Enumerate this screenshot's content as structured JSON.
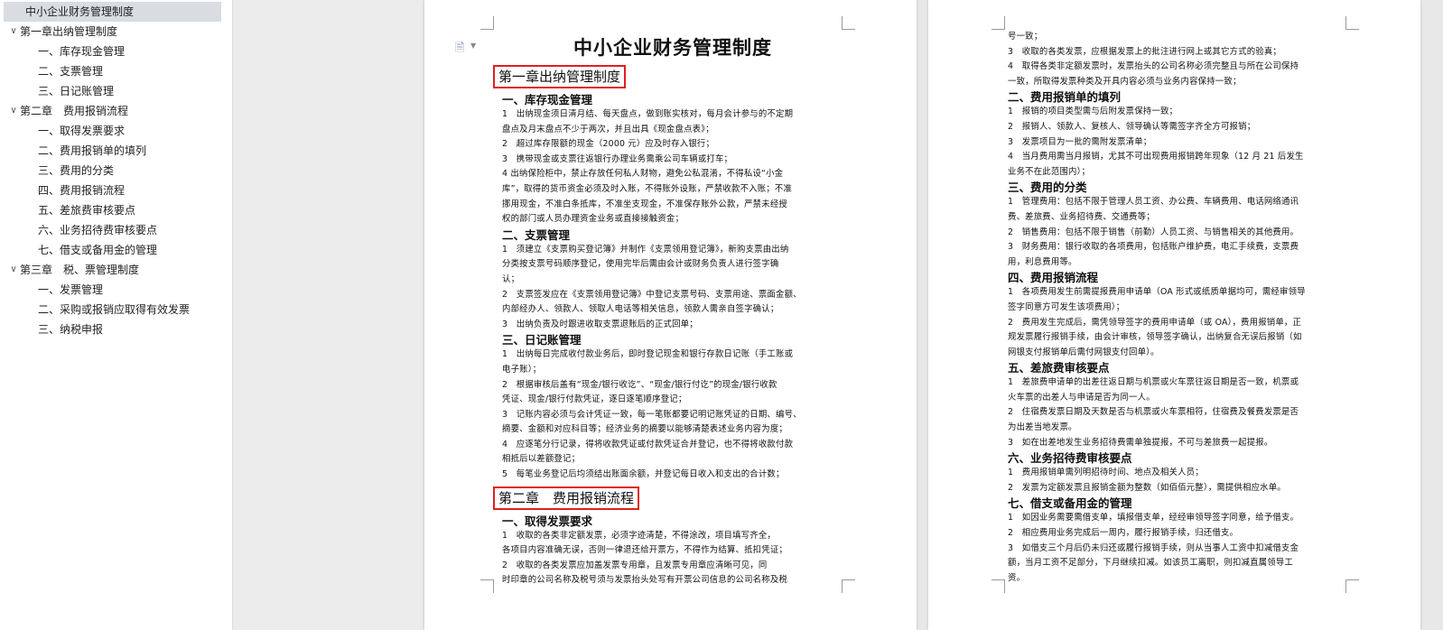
{
  "nav": {
    "root": "中小企业财务管理制度",
    "items": [
      {
        "label": "第一章出纳管理制度",
        "level": 1
      },
      {
        "label": "一、库存现金管理",
        "level": 2
      },
      {
        "label": "二、支票管理",
        "level": 2
      },
      {
        "label": "三、日记账管理",
        "level": 2
      },
      {
        "label": "第二章　费用报销流程",
        "level": 1
      },
      {
        "label": "一、取得发票要求",
        "level": 2
      },
      {
        "label": "二、费用报销单的填列",
        "level": 2
      },
      {
        "label": "三、费用的分类",
        "level": 2
      },
      {
        "label": "四、费用报销流程",
        "level": 2
      },
      {
        "label": "五、差旅费审核要点",
        "level": 2
      },
      {
        "label": "六、业务招待费审核要点",
        "level": 2
      },
      {
        "label": "七、借支或备用金的管理",
        "level": 2
      },
      {
        "label": "第三章　税、票管理制度",
        "level": 1
      },
      {
        "label": "一、发票管理",
        "level": 2
      },
      {
        "label": "二、采购或报销应取得有效发票",
        "level": 2
      },
      {
        "label": "三、纳税申报",
        "level": 2
      }
    ]
  },
  "page1": {
    "title": "中小企业财务管理制度",
    "chapter1": "第一章出纳管理制度",
    "s1": "一、库存现金管理",
    "s1_p": [
      "1　出纳现金须日清月结、每天盘点，做到账实核对，每月会计参与的不定期",
      "盘点及月末盘点不少于两次，并且出具《现金盘点表》；",
      "2　超过库存限额的现金（2000 元）应及时存入银行；",
      "3　携带现金或支票往返银行办理业务需乘公司车辆或打车；",
      "4 出纳保险柜中，禁止存放任何私人财物，避免公私混淆，不得私设“小金",
      "库”，取得的货币资金必须及时入账，不得账外设账，严禁收款不入账；不准",
      "挪用现金，不准白条抵库，不准坐支现金，不准保存账外公款，严禁未经授",
      "权的部门或人员办理资金业务或直接接触资金；"
    ],
    "s2": "二、支票管理",
    "s2_p": [
      "1　须建立《支票购买登记簿》并制作《支票领用登记簿》，新购支票由出纳",
      "分类按支票号码顺序登记，使用完毕后需由会计或财务负责人进行签字确",
      "认；",
      "2　支票签发应在《支票领用登记簿》中登记支票号码、支票用途、票面金额、",
      "内部经办人、领款人、领取人电话等相关信息，领款人需亲自签字确认；",
      "3　出纳负责及时跟进收取支票退账后的正式回单；"
    ],
    "s3": "三、日记账管理",
    "s3_p": [
      "1　出纳每日完成收付款业务后，即时登记现金和银行存款日记账（手工账或",
      "电子账）；",
      "2　根据审核后盖有“现金/银行收讫”、“现金/银行付讫”的现金/银行收款",
      "凭证、现金/银行付款凭证，逐日逐笔顺序登记；",
      "3　记账内容必须与会计凭证一致，每一笔账都要记明记账凭证的日期、编号、",
      "摘要、金额和对应科目等；经济业务的摘要以能够清楚表述业务内容为度；",
      "4　应逐笔分行记录，得将收款凭证或付款凭证合并登记，也不得将收款付款",
      "相抵后以差额登记；",
      "5　每笔业务登记后均须结出账面余额，并登记每日收入和支出的合计数；"
    ],
    "chapter2": "第二章　费用报销流程",
    "s4": "一、取得发票要求",
    "s4_p": [
      "1　收取的各类非定额发票，必须字迹清楚，不得涂改，项目填写齐全，",
      "各项目内容准确无误，否则一律退还给开票方，不得作为结算、抵扣凭证；",
      "2　收取的各类发票应加盖发票专用章，且发票专用章应清晰可见，同",
      "时印章的公司名称及税号须与发票抬头处写有开票公司信息的公司名称及税"
    ]
  },
  "page2": {
    "p0": [
      "号一致；",
      "3　收取的各类发票，应根据发票上的批注进行网上或其它方式的验真；",
      "4　取得各类非定额发票时，发票抬头的公司名称必须完整且与所在公司保持",
      "一致，所取得发票种类及开具内容必须与业务内容保持一致；"
    ],
    "s2": "二、费用报销单的填列",
    "s2_p": [
      "1　报销的项目类型需与后附发票保持一致；",
      "2　报销人、领款人、复核人、领导确认等需签字齐全方可报销；",
      "3　发票项目为一批的需附发票清单；",
      "4　当月费用需当月报销，尤其不可出现费用报销跨年现象（12 月 21 后发生",
      "业务不在此范围内）；"
    ],
    "s3": "三、费用的分类",
    "s3_p": [
      "1　管理费用：包括不限于管理人员工资、办公费、车辆费用、电话网络通讯",
      "费、差旅费、业务招待费、交通费等；",
      "2　销售费用：包括不限于销售（前勤）人员工资、与销售相关的其他费用。",
      "3　财务费用：银行收取的各项费用，包括账户维护费，电汇手续费，支票费",
      "用，利息费用等。"
    ],
    "s4": "四、费用报销流程",
    "s4_p": [
      "1　各项费用发生前需提报费用申请单（OA 形式或纸质单据均可，需经审领导",
      "签字同意方可发生该项费用）；",
      "2　费用发生完成后，需凭领导签字的费用申请单（或 OA），费用报销单，正",
      "规发票履行报销手续，由会计审核，领导签字确认，出纳复合无误后报销（如",
      "网银支付报销单后需付网银支付回单）。"
    ],
    "s5": "五、差旅费审核要点",
    "s5_p": [
      "1　差旅费申请单的出差往返日期与机票或火车票往返日期是否一致，机票或",
      "火车票的出差人与申请是否为同一人。",
      "2　住宿费发票日期及天数是否与机票或火车票相符，住宿费及餐费发票是否",
      "为出差当地发票。",
      "3　如在出差地发生业务招待费需单独提报，不可与差旅费一起提报。"
    ],
    "s6": "六、业务招待费审核要点",
    "s6_p": [
      "1　费用报销单需列明招待时间、地点及相关人员；",
      "2　发票为定额发票且报销金额为整数（如佰佰元整），需提供相应水单。"
    ],
    "s7": "七、借支或备用金的管理",
    "s7_p": [
      "1　如因业务需要需借支单，填报借支单，经经审领导签字同意，给予借支。",
      "2　相应费用业务完成后一周内，履行报销手续，归还借支。",
      "3　如借支三个月后仍未归还或履行报销手续，则从当事人工资中扣减借支金",
      "额，当月工资不足部分，下月继续扣减。如该员工离职，则扣减直属领导工",
      "资。"
    ]
  },
  "colors": {
    "highlight_border": "#e02020",
    "nav_selected": "#d9dde2"
  }
}
